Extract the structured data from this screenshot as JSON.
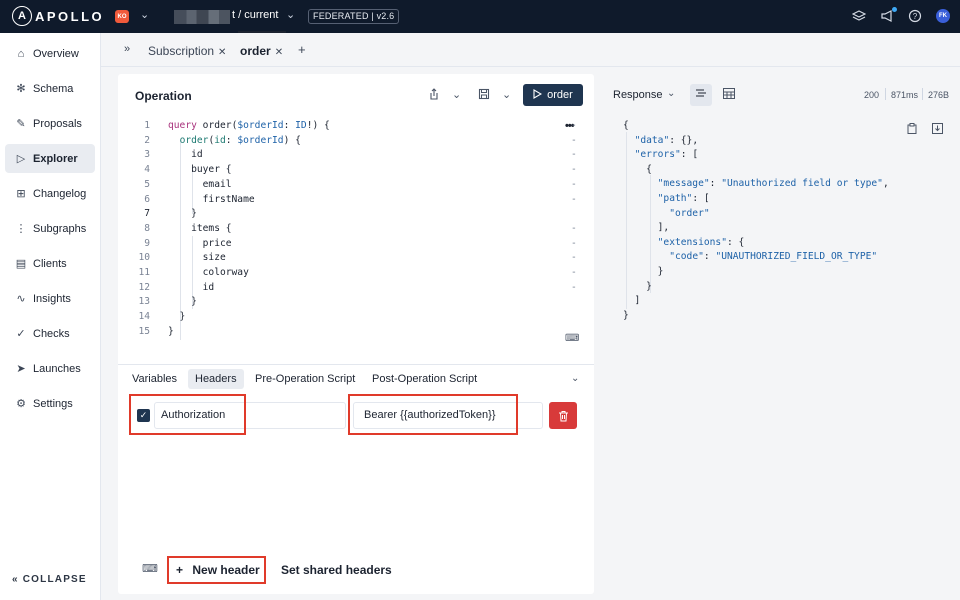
{
  "topbar": {
    "logo_text": "APOLLO",
    "logo_mark": "A",
    "org_initials": "KO",
    "graph_label": "t / current",
    "federation_badge": "FEDERATED | v2.6",
    "user_initials": "FK"
  },
  "sidebar": {
    "items": [
      {
        "label": "Overview",
        "icon": "home-icon"
      },
      {
        "label": "Schema",
        "icon": "schema-icon"
      },
      {
        "label": "Proposals",
        "icon": "proposals-icon"
      },
      {
        "label": "Explorer",
        "icon": "explorer-icon",
        "active": true
      },
      {
        "label": "Changelog",
        "icon": "changelog-icon"
      },
      {
        "label": "Subgraphs",
        "icon": "subgraphs-icon"
      },
      {
        "label": "Clients",
        "icon": "clients-icon"
      },
      {
        "label": "Insights",
        "icon": "insights-icon"
      },
      {
        "label": "Checks",
        "icon": "checks-icon"
      },
      {
        "label": "Launches",
        "icon": "launches-icon"
      },
      {
        "label": "Settings",
        "icon": "settings-icon"
      }
    ],
    "collapse_label": "COLLAPSE"
  },
  "tabs": {
    "items": [
      {
        "label": "Subscription",
        "active": false
      },
      {
        "label": "order",
        "active": true
      }
    ]
  },
  "operation": {
    "title": "Operation",
    "run_label": "order",
    "lines": [
      {
        "num": "1",
        "text": "query order($orderId: ID!) {",
        "fold": "-"
      },
      {
        "num": "2",
        "text": "  order(id: $orderId) {",
        "fold": "-"
      },
      {
        "num": "3",
        "text": "    id",
        "fold": "-"
      },
      {
        "num": "4",
        "text": "    buyer {",
        "fold": "-"
      },
      {
        "num": "5",
        "text": "      email",
        "fold": "-"
      },
      {
        "num": "6",
        "text": "      firstName",
        "fold": "-"
      },
      {
        "num": "7",
        "text": "    }",
        "fold": ""
      },
      {
        "num": "8",
        "text": "    items {",
        "fold": "-"
      },
      {
        "num": "9",
        "text": "      price",
        "fold": "-"
      },
      {
        "num": "10",
        "text": "      size",
        "fold": "-"
      },
      {
        "num": "11",
        "text": "      colorway",
        "fold": "-"
      },
      {
        "num": "12",
        "text": "      id",
        "fold": "-"
      },
      {
        "num": "13",
        "text": "    }",
        "fold": ""
      },
      {
        "num": "14",
        "text": "  }",
        "fold": ""
      },
      {
        "num": "15",
        "text": "}",
        "fold": ""
      }
    ]
  },
  "bottom_tabs": {
    "items": [
      {
        "label": "Variables",
        "active": false
      },
      {
        "label": "Headers",
        "active": true
      },
      {
        "label": "Pre-Operation Script",
        "active": false
      },
      {
        "label": "Post-Operation Script",
        "active": false
      }
    ]
  },
  "headers": {
    "rows": [
      {
        "checked": true,
        "key": "Authorization",
        "value": "Bearer {{authorizedToken}}"
      }
    ],
    "new_header_label": "New header",
    "shared_headers_label": "Set shared headers"
  },
  "response": {
    "label": "Response",
    "status": "200",
    "time": "871ms",
    "size": "276B",
    "lines": [
      "{",
      "  \"data\": {},",
      "  \"errors\": [",
      "    {",
      "      \"message\": \"Unauthorized field or type\",",
      "      \"path\": [",
      "        \"order\"",
      "      ],",
      "      \"extensions\": {",
      "        \"code\": \"UNAUTHORIZED_FIELD_OR_TYPE\"",
      "      }",
      "    }",
      "  ]",
      "}"
    ]
  },
  "colors": {
    "topbar": "#0f1a2b",
    "run_button": "#1f3550",
    "delete_button": "#d83a3a",
    "highlight_box": "#e03a2a"
  }
}
